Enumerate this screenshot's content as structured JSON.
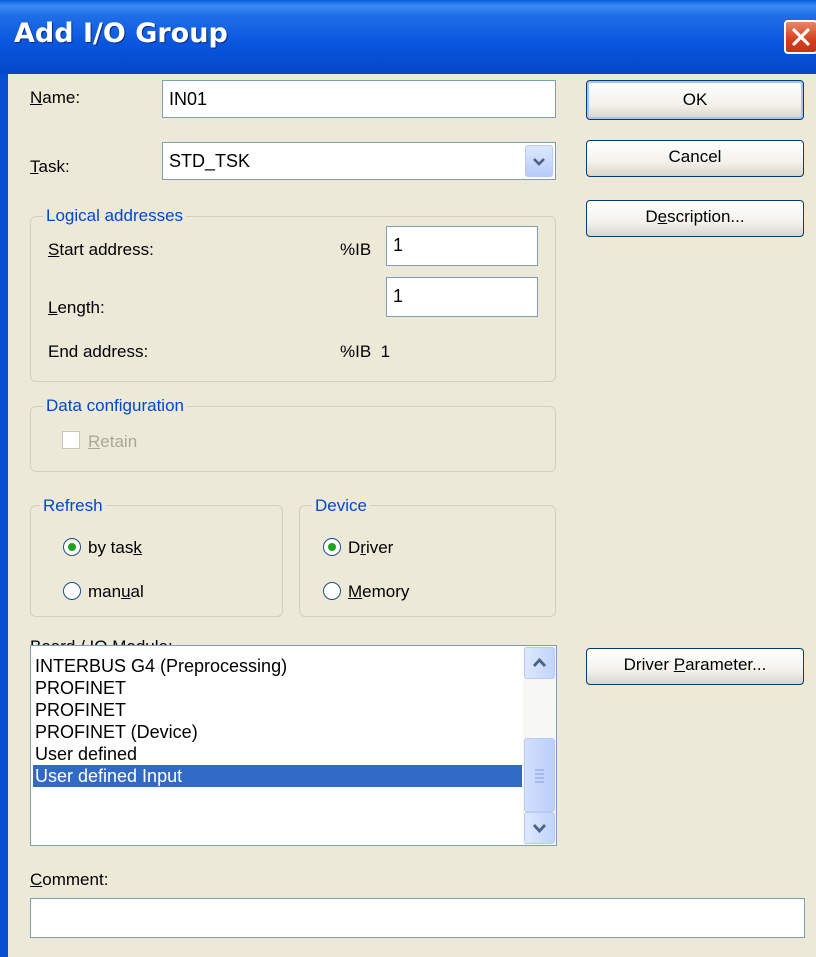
{
  "window": {
    "title": "Add I/O Group"
  },
  "form": {
    "name_label": "Name:",
    "name_value": "IN01",
    "task_label": "Task:",
    "task_value": "STD_TSK",
    "comment_label": "Comment:",
    "comment_value": ""
  },
  "buttons": {
    "ok": "OK",
    "cancel": "Cancel",
    "description": "Description...",
    "driver_parameter": "Driver Parameter..."
  },
  "logical_addresses": {
    "title": "Logical addresses",
    "start_label": "Start address:",
    "start_prefix": "%IB",
    "start_value": "1",
    "length_label": "Length:",
    "length_value": "1",
    "end_label": "End address:",
    "end_value": "%IB  1"
  },
  "data_configuration": {
    "title": "Data configuration",
    "retain_label": "Retain",
    "retain_checked": false
  },
  "refresh": {
    "title": "Refresh",
    "by_task": "by task",
    "manual": "manual",
    "selected": "by task"
  },
  "device": {
    "title": "Device",
    "driver": "Driver",
    "memory": "Memory",
    "selected": "Driver"
  },
  "board": {
    "label": "Board / IO Module:",
    "items": [
      "INTERBUS G4 (Preprocessing)",
      "PROFINET",
      "PROFINET",
      "PROFINET (Device)",
      "User defined",
      "User defined Input"
    ],
    "selected_index": 5
  },
  "colors": {
    "titlebar": "#0855dd",
    "selection": "#316ac5",
    "group_title": "#0046d5",
    "background": "#ece9d8"
  },
  "icons": {
    "close": "close-icon",
    "dropdown": "chevron-down-icon",
    "scroll_up": "scroll-up-icon",
    "scroll_down": "scroll-down-icon"
  }
}
